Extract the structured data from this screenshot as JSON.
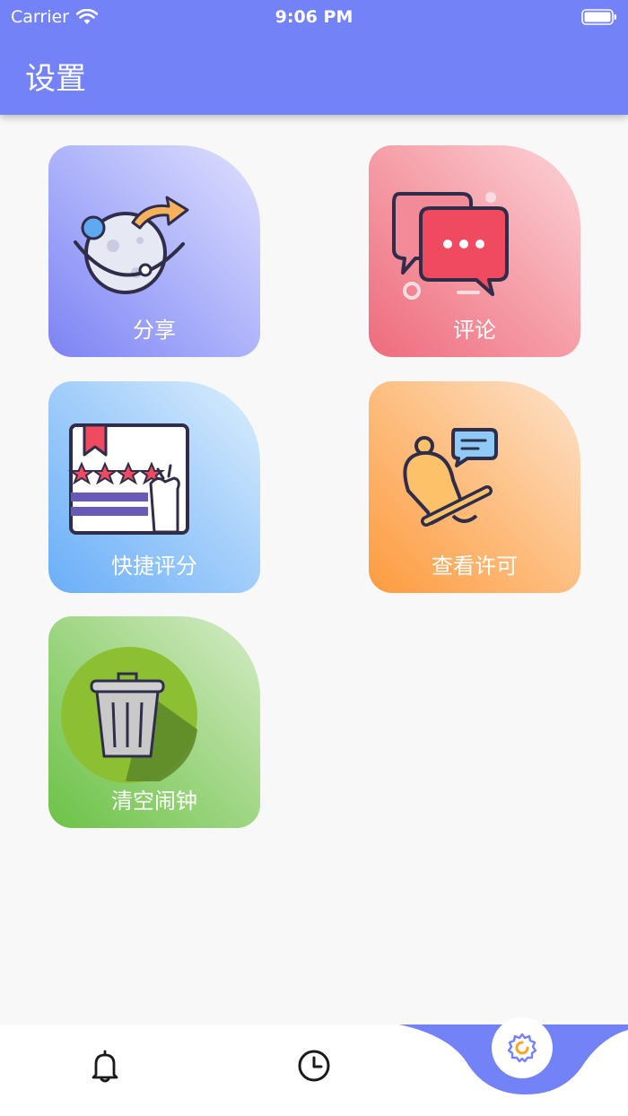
{
  "status_bar": {
    "carrier": "Carrier",
    "time": "9:06 PM"
  },
  "header": {
    "title": "设置"
  },
  "cards": {
    "share": {
      "label": "分享"
    },
    "review": {
      "label": "评论"
    },
    "rate": {
      "label": "快捷评分"
    },
    "permissions": {
      "label": "查看许可"
    },
    "clear_alarms": {
      "label": "清空闹钟"
    }
  },
  "tabbar": {
    "tabs": [
      {
        "icon": "bell-icon"
      },
      {
        "icon": "clock-icon"
      },
      {
        "icon": "settings-gear-icon",
        "selected": true
      }
    ],
    "accent": "#7482f7",
    "active_icon_color": "#f5a623"
  },
  "colors": {
    "header": "#7482f7",
    "background": "#f8f8f8"
  }
}
